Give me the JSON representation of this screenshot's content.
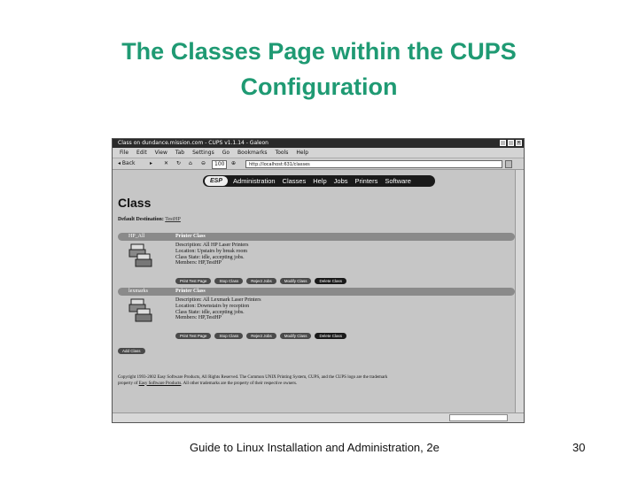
{
  "slide": {
    "title_line1": "The Classes Page within the CUPS",
    "title_line2": "Configuration",
    "footer": "Guide to Linux Installation and Administration, 2e",
    "page_number": "30",
    "title_color": "#1f9a73"
  },
  "browser": {
    "window_title": "Class on dundance.mission.com - CUPS v1.1.14 - Galeon",
    "menu": [
      "File",
      "Edit",
      "View",
      "Tab",
      "Settings",
      "Go",
      "Bookmarks",
      "Tools",
      "Help"
    ],
    "toolbar": {
      "back": "◂ Back",
      "forward": "▸",
      "zoom": "100",
      "url": "http://localhost:631/classes"
    }
  },
  "cups": {
    "nav": {
      "logo": "ESP",
      "links": [
        "Administration",
        "Classes",
        "Help",
        "Jobs",
        "Printers",
        "Software"
      ]
    },
    "heading": "Class",
    "default_dest_label": "Default Destination:",
    "default_dest_value": "TestHP",
    "classes": [
      {
        "name": "HP_All",
        "header": "Printer Class",
        "description": "Description: All HP Laser Printers",
        "location": "Location: Upstairs by break room",
        "state": "Class State: idle, accepting jobs.",
        "members": "Members: HP,TestHP",
        "buttons": [
          "Print Test Page",
          "Stop Class",
          "Reject Jobs",
          "Modify Class",
          "Delete Class"
        ]
      },
      {
        "name": "lexmarks",
        "header": "Printer Class",
        "description": "Description: All Lexmark Laser Printers",
        "location": "Location: Downstairs by reception",
        "state": "Class State: idle, accepting jobs.",
        "members": "Members: HP,TestHP",
        "buttons": [
          "Print Test Page",
          "Stop Class",
          "Reject Jobs",
          "Modify Class",
          "Delete Class"
        ]
      }
    ],
    "add_class": "Add Class",
    "copyright_line1": "Copyright 1993-2002 Easy Software Products, All Rights Reserved. The Common UNIX Printing System, CUPS, and the CUPS logo are the trademark",
    "copyright_line2_pre": "property of",
    "copyright_link": "Easy Software Products",
    "copyright_line2_post": ". All other trademarks are the property of their respective owners."
  }
}
